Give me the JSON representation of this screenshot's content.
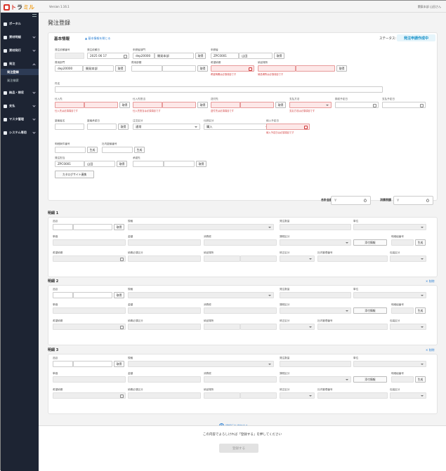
{
  "app": {
    "version": "Version 1.16.1",
    "user": "関東本部 山田さん",
    "logo_a": "ト",
    "logo_b": "ラ",
    "logo_c": "ミル"
  },
  "sidebar": {
    "items": [
      {
        "label": "ポータル"
      },
      {
        "label": "資材明細"
      },
      {
        "label": "資材発行"
      },
      {
        "label": "発注"
      },
      {
        "label": "納品・検収"
      },
      {
        "label": "支払"
      },
      {
        "label": "マスタ管理"
      },
      {
        "label": "システム専用"
      }
    ],
    "sub_items": [
      {
        "label": "発注登録"
      },
      {
        "label": "発注検索"
      }
    ]
  },
  "page": {
    "title": "発注登録"
  },
  "basic": {
    "title": "基本情報",
    "toggle_link": "▲ 基本情報を閉じる",
    "status_label": "ステータス:",
    "status_value": "発注申請作成中",
    "fields": {
      "order_no_label": "発注依頼番号",
      "order_date_label": "発注依頼日",
      "order_date_value": "2025 06 17",
      "req_dept_label": "申請者部門",
      "req_dept_code": "dep20000",
      "req_dept_name": "開発本部",
      "applicant_label": "申請者",
      "applicant_code": "ZPC0001",
      "applicant_name": "山田",
      "budget_dept_label": "費用部門",
      "budget_dept_code": "dep20000",
      "budget_dept_name": "開発本部",
      "budget_cat_label": "費用部類",
      "desired_date_label": "希望納期",
      "desired_date_err": "希望納期は必須項目です",
      "delivery_place_label": "納品場所",
      "delivery_place_err": "納品場所は必須項目です",
      "subject_label": "件名",
      "supplier_label": "仕入先",
      "supplier_err": "仕入先は必須項目です",
      "supplier_contact_label": "仕入先担当",
      "supplier_contact_err": "仕入先担当は必須項目です",
      "dest_label": "送付先",
      "dest_err": "送付先は必須項目です",
      "pay_method_label": "支払方法",
      "pay_method_err": "支払方法は必須項目です",
      "inspect_date_label": "検収予定日",
      "pay_date_label": "支払予定日",
      "approver_label": "稟議者名",
      "approval_date_label": "稟議承認日",
      "order_type_label": "注文区分",
      "order_type_value": "通常",
      "buy_type_label": "仕訳区分",
      "buy_type_value": "購入",
      "delivery_due_label": "納入予定日",
      "delivery_due_err": "納入予定日は必須項目です",
      "project_label": "明細案件番号",
      "company_label": "社内稟議番号",
      "orderer_label": "発注担当",
      "orderer_code": "ZPC0001",
      "orderer_name": "山田",
      "receiver_label": "承認先",
      "catalog_btn": "カタログサイト連携",
      "search_btn": "取得",
      "search_btn2": "取得"
    }
  },
  "totals": {
    "sum_label": "合計金額",
    "sum_value": "0",
    "tax_label": "消費税額",
    "tax_value": "0",
    "yen": "¥"
  },
  "detail_labels": {
    "item_code": "品目",
    "item_name": "規格",
    "qty": "発注数量",
    "unit": "単位",
    "price": "単価",
    "amount": "金額",
    "tax": "消費税",
    "tax_cat": "課税区分",
    "attach_btn": "添付情報",
    "detail_no": "明細組番号",
    "desired": "希望納期",
    "delivery_cat": "納期必須区分",
    "place": "納品場所",
    "fix_cat": "修正区分",
    "mgmt_no": "社内管理番号",
    "pack_cat": "包装区分",
    "fetch_btn": "取得",
    "gen_btn": "生成",
    "delete_link": "✕ 削除"
  },
  "details": [
    {
      "title": "明細 1"
    },
    {
      "title": "明細 2"
    },
    {
      "title": "明細 3"
    }
  ],
  "add_line": "明細行を追加する",
  "footer": {
    "message": "この内容でよろしければ「登録する」を押してください",
    "register_btn": "登録する"
  }
}
